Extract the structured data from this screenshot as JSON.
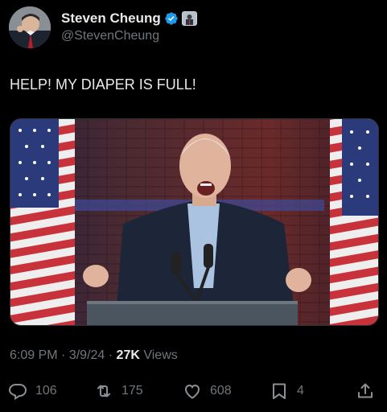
{
  "author": {
    "name": "Steven Cheung",
    "handle": "@StevenCheung"
  },
  "tweet": {
    "text": "HELP! MY DIAPER IS FULL!"
  },
  "meta": {
    "time": "6:09 PM",
    "date": "3/9/24",
    "views_count": "27K",
    "views_label": "Views"
  },
  "actions": {
    "replies": "106",
    "reposts": "175",
    "likes": "608",
    "bookmarks": "4"
  },
  "colors": {
    "background": "#000000",
    "text": "#e7e9ea",
    "muted": "#71767b",
    "verified": "#1d9bf0"
  },
  "icons": [
    "verified-badge-icon",
    "affiliate-badge-icon",
    "reply-icon",
    "repost-icon",
    "like-icon",
    "bookmark-icon",
    "share-icon"
  ]
}
